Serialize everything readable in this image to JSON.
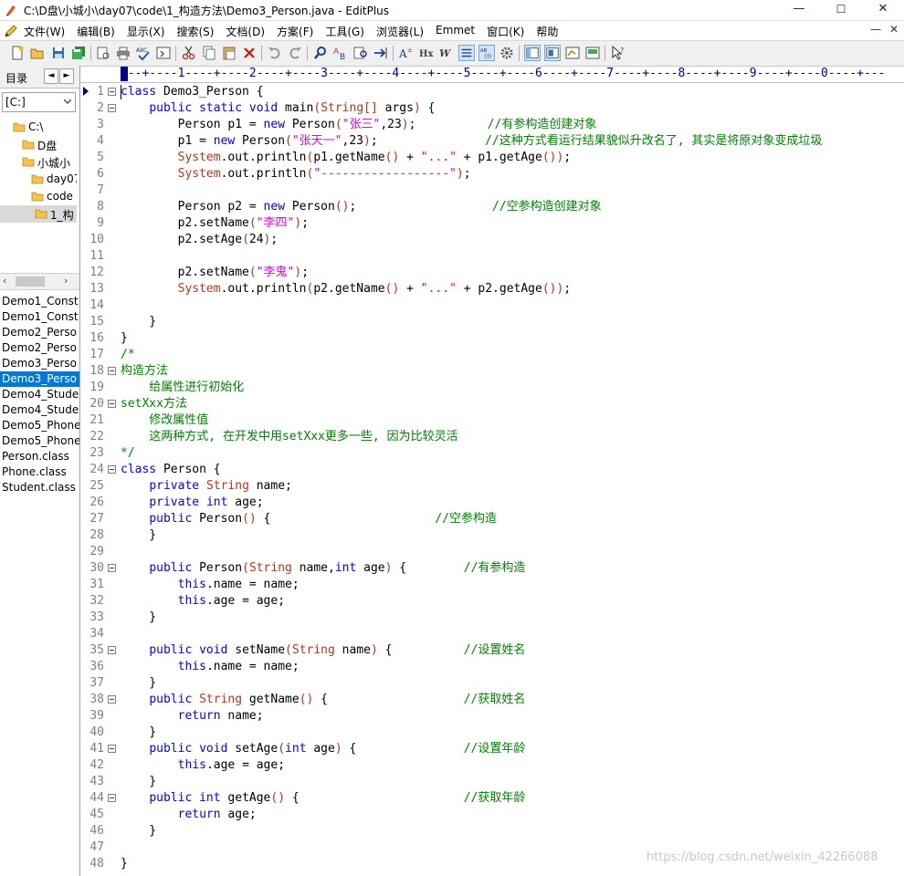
{
  "window": {
    "title": "C:\\D盘\\小城小\\day07\\code\\1_构造方法\\Demo3_Person.java - EditPlus",
    "minimize": "—",
    "maximize": "☐",
    "close": "✕"
  },
  "menu": {
    "items": [
      "文件(W)",
      "编辑(B)",
      "显示(X)",
      "搜索(S)",
      "文档(D)",
      "方案(F)",
      "工具(G)",
      "浏览器(L)",
      "Emmet",
      "窗口(K)",
      "帮助"
    ],
    "tail_minimize": "—",
    "tail_close": "✕"
  },
  "colors": {
    "keyword": "#0000ff",
    "type": "#b5351c",
    "string": "#df00df",
    "comment": "#008000",
    "selection": "#0078d7"
  },
  "sidebar": {
    "directory_label": "目录",
    "drive": "[C:]",
    "folders": [
      {
        "name": "C:\\",
        "icon": "folder-open-icon"
      },
      {
        "name": "D盘",
        "icon": "folder-open-icon"
      },
      {
        "name": "小城小",
        "icon": "folder-open-icon"
      },
      {
        "name": "day07",
        "icon": "folder-open-icon"
      },
      {
        "name": "code",
        "icon": "folder-open-icon"
      },
      {
        "name": "1_构",
        "icon": "folder-open-icon"
      }
    ],
    "files": [
      "Demo1_Const",
      "Demo1_Const",
      "Demo2_Perso",
      "Demo2_Perso",
      "Demo3_Perso",
      "Demo3_Perso",
      "Demo4_Stude",
      "Demo4_Stude",
      "Demo5_Phone",
      "Demo5_Phone",
      "Person.class",
      "Phone.class",
      "Student.class"
    ]
  },
  "editor": {
    "ruler": "---+----1----+----2----+----3----+----4----+----5----+----6----+----7----+----8----+----9----+----0----+---",
    "lines": [
      "class Demo3_Person {",
      "    public static void main(String[] args) {",
      "        Person p1 = new Person(\"张三\",23);          //有参构造创建对象",
      "        p1 = new Person(\"张天一\",23);               //这种方式看运行结果貌似升改名了, 其实是将原对象变成垃圾",
      "        System.out.println(p1.getName() + \"...\" + p1.getAge());",
      "        System.out.println(\"------------------\");",
      "",
      "        Person p2 = new Person();                   //空参构造创建对象",
      "        p2.setName(\"李四\");",
      "        p2.setAge(24);",
      "",
      "        p2.setName(\"李鬼\");",
      "        System.out.println(p2.getName() + \"...\" + p2.getAge());",
      "",
      "    }",
      "}",
      "/*",
      "构造方法",
      "    给属性进行初始化",
      "setXxx方法",
      "    修改属性值",
      "    这两种方式, 在开发中用setXxx更多一些, 因为比较灵活",
      "*/",
      "class Person {",
      "    private String name;",
      "    private int age;",
      "    public Person() {                       //空参构造",
      "    }",
      "",
      "    public Person(String name,int age) {        //有参构造",
      "        this.name = name;",
      "        this.age = age;",
      "    }",
      "",
      "    public void setName(String name) {          //设置姓名",
      "        this.name = name;",
      "    }",
      "    public String getName() {                   //获取姓名",
      "        return name;",
      "    }",
      "    public void setAge(int age) {               //设置年龄",
      "        this.age = age;",
      "    }",
      "    public int getAge() {                       //获取年龄",
      "        return age;",
      "    }",
      "",
      "}"
    ],
    "fold_lines": [
      1,
      2,
      18,
      20,
      24,
      30,
      35,
      38,
      41,
      44
    ]
  },
  "watermark": "https://blog.csdn.net/weixin_42266088"
}
